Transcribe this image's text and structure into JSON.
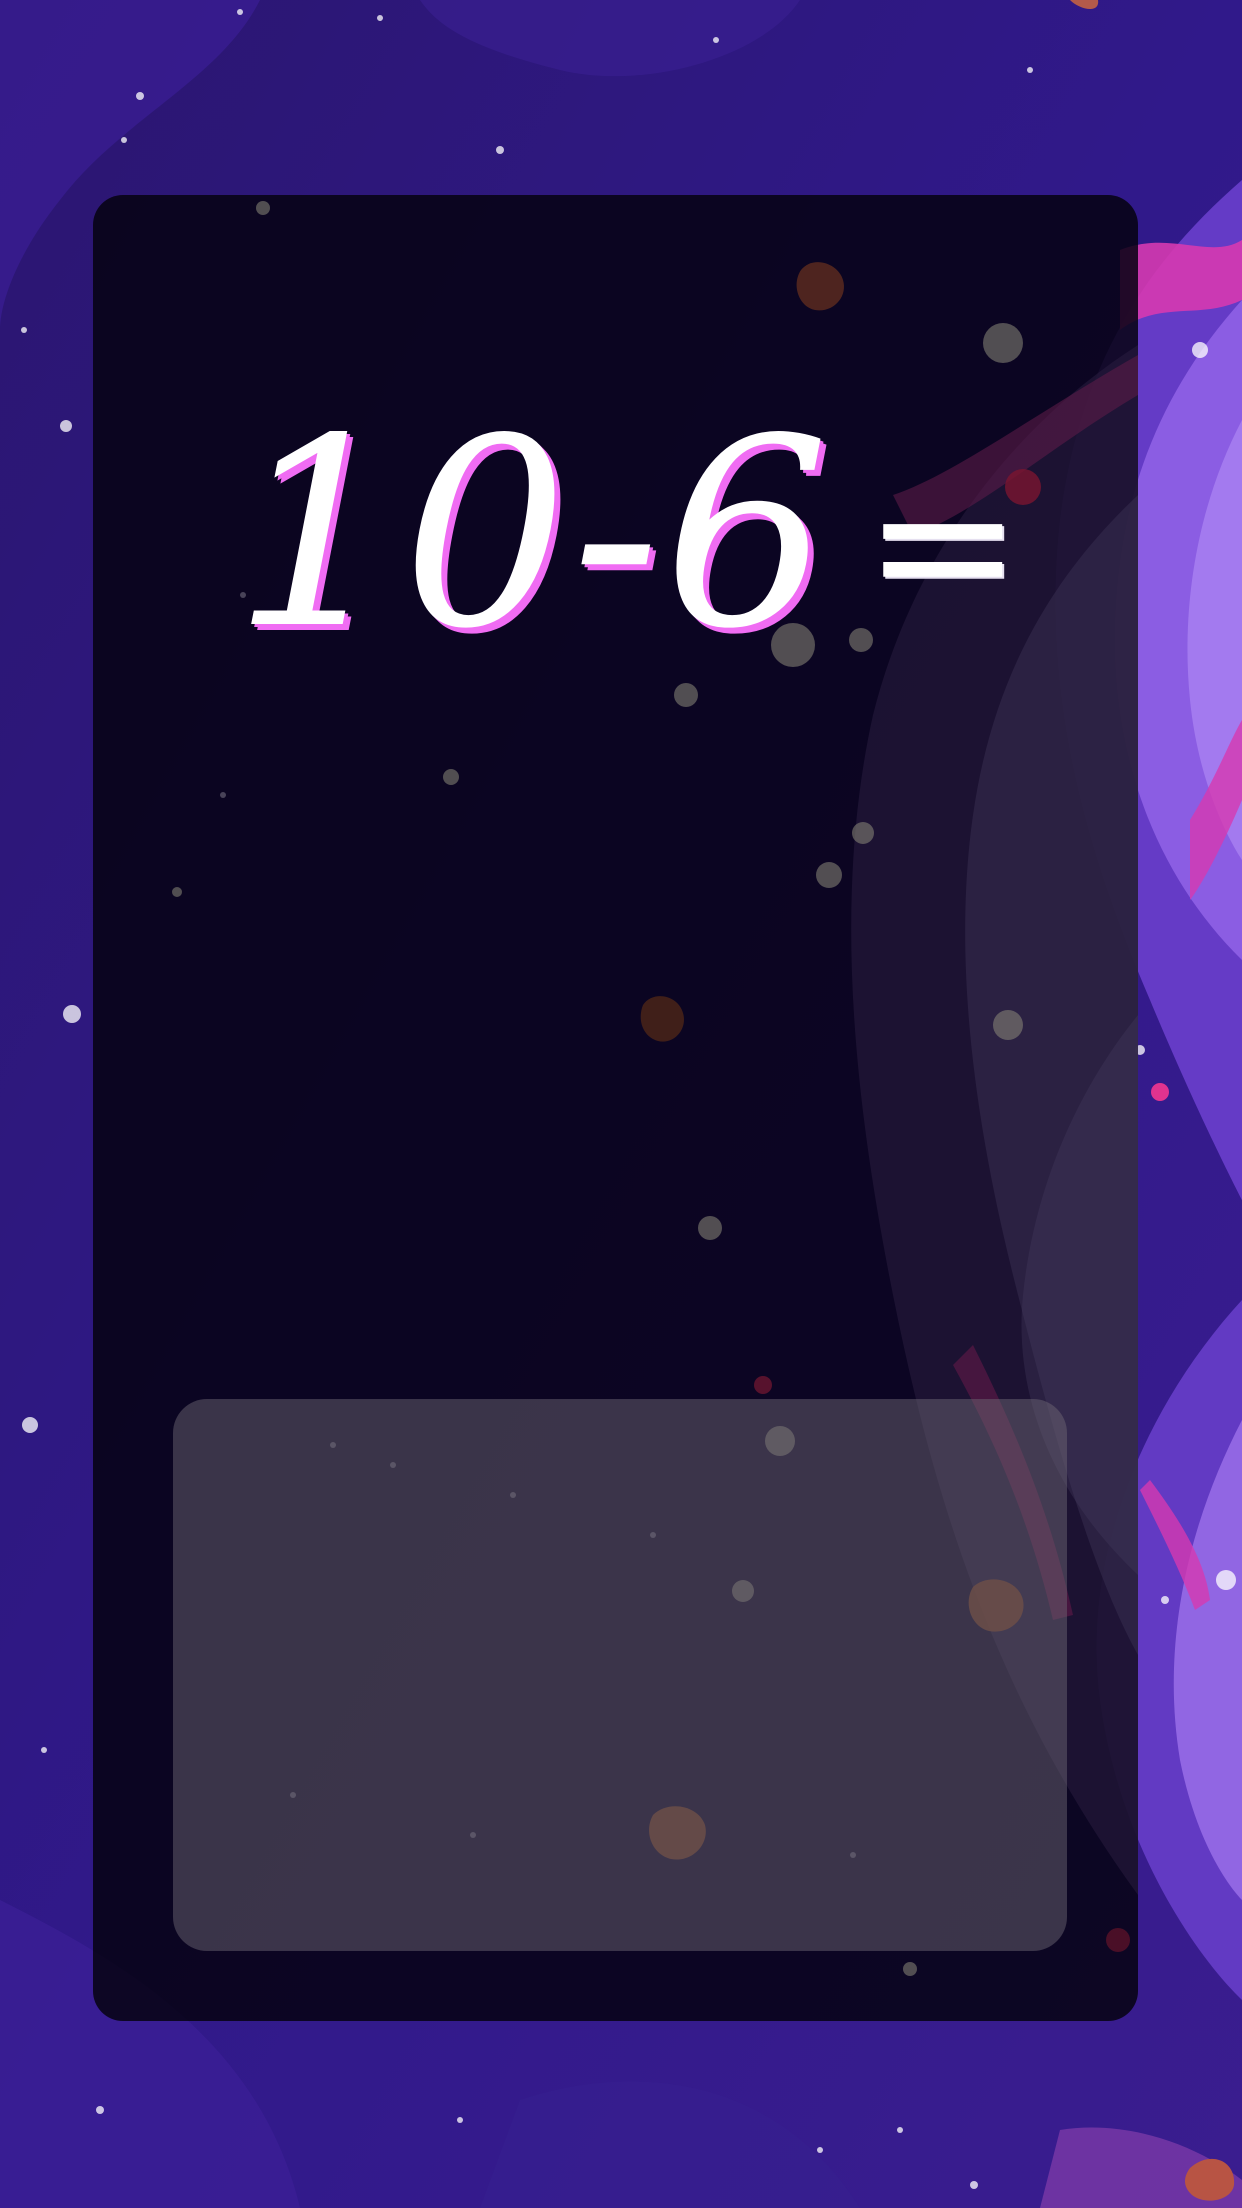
{
  "game": {
    "equation": {
      "left_operand": "10",
      "operator": "-",
      "right_operand": "6",
      "equals_sign": "="
    },
    "answer_box": {
      "value": ""
    }
  },
  "colors": {
    "background_purple": "#2e1a7c",
    "nebula_violet": "#8a5be0",
    "nebula_magenta": "#d63ab0",
    "panel_dark": "#08031a",
    "digit_fill": "#ffffff",
    "digit_shadow": "#f06cf3",
    "answer_box_fill": "#5a5460"
  }
}
